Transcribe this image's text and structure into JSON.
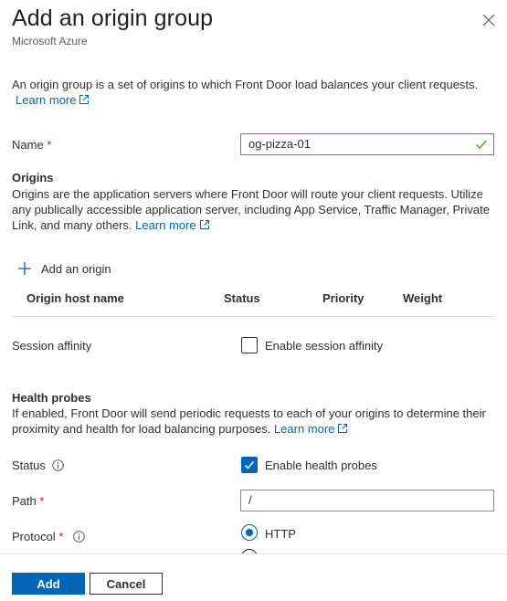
{
  "header": {
    "title": "Add an origin group",
    "subtitle": "Microsoft Azure",
    "close_icon": "close-icon"
  },
  "intro": {
    "text": "An origin group is a set of origins to which Front Door load balances your client requests.",
    "learn_more": "Learn more"
  },
  "name_field": {
    "label": "Name",
    "required_mark": "*",
    "value": "og-pizza-01",
    "valid": true
  },
  "origins": {
    "heading": "Origins",
    "description_line1": "Origins are the application servers where Front Door will route your client requests. Utilize",
    "description_line2": "any publically accessible application server, including App Service, Traffic Manager, Private",
    "description_line3": "Link, and many others.",
    "learn_more": "Learn more",
    "add_button": "Add an origin",
    "table_headers": [
      "Origin host name",
      "Status",
      "Priority",
      "Weight"
    ]
  },
  "session_affinity": {
    "label": "Session affinity",
    "checkbox_label": "Enable session affinity",
    "checked": false
  },
  "health_probes": {
    "heading": "Health probes",
    "description_line1": "If enabled, Front Door will send periodic requests to each of your origins to determine their",
    "description_line2": "proximity and health for load balancing purposes.",
    "learn_more": "Learn more",
    "status_label": "Status",
    "status_checkbox_label": "Enable health probes",
    "status_checked": true,
    "path_label": "Path",
    "path_required_mark": "*",
    "path_value": "/",
    "protocol_label": "Protocol",
    "protocol_required_mark": "*",
    "protocol_options": [
      "HTTP"
    ],
    "protocol_selected": "HTTP"
  },
  "footer": {
    "add_label": "Add",
    "cancel_label": "Cancel"
  },
  "colors": {
    "accent": "#0067b8",
    "required": "#a4262c",
    "valid_check": "#57a300"
  }
}
